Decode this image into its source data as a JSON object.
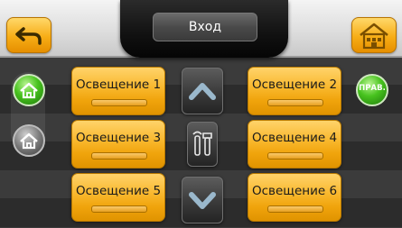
{
  "header": {
    "title": "Вход",
    "back_icon": "back-arrow-icon",
    "home_icon": "home-icon"
  },
  "side_left": [
    {
      "icon": "house-green-icon",
      "state": "active"
    },
    {
      "icon": "house-gray-icon",
      "state": "inactive"
    }
  ],
  "side_right": {
    "label": "ПРАВ."
  },
  "lights": [
    {
      "label": "Освещение 1"
    },
    {
      "label": "Освещение 2"
    },
    {
      "label": "Освещение 3"
    },
    {
      "label": "Освещение 4"
    },
    {
      "label": "Освещение 5"
    },
    {
      "label": "Освещение 6"
    }
  ],
  "center": {
    "up_icon": "chevron-up-icon",
    "tools_icon": "tools-icon",
    "down_icon": "chevron-down-icon"
  },
  "colors": {
    "accent": "#f7ad16",
    "background_dark": "#2c2c2c",
    "active_green": "#47c21e"
  }
}
